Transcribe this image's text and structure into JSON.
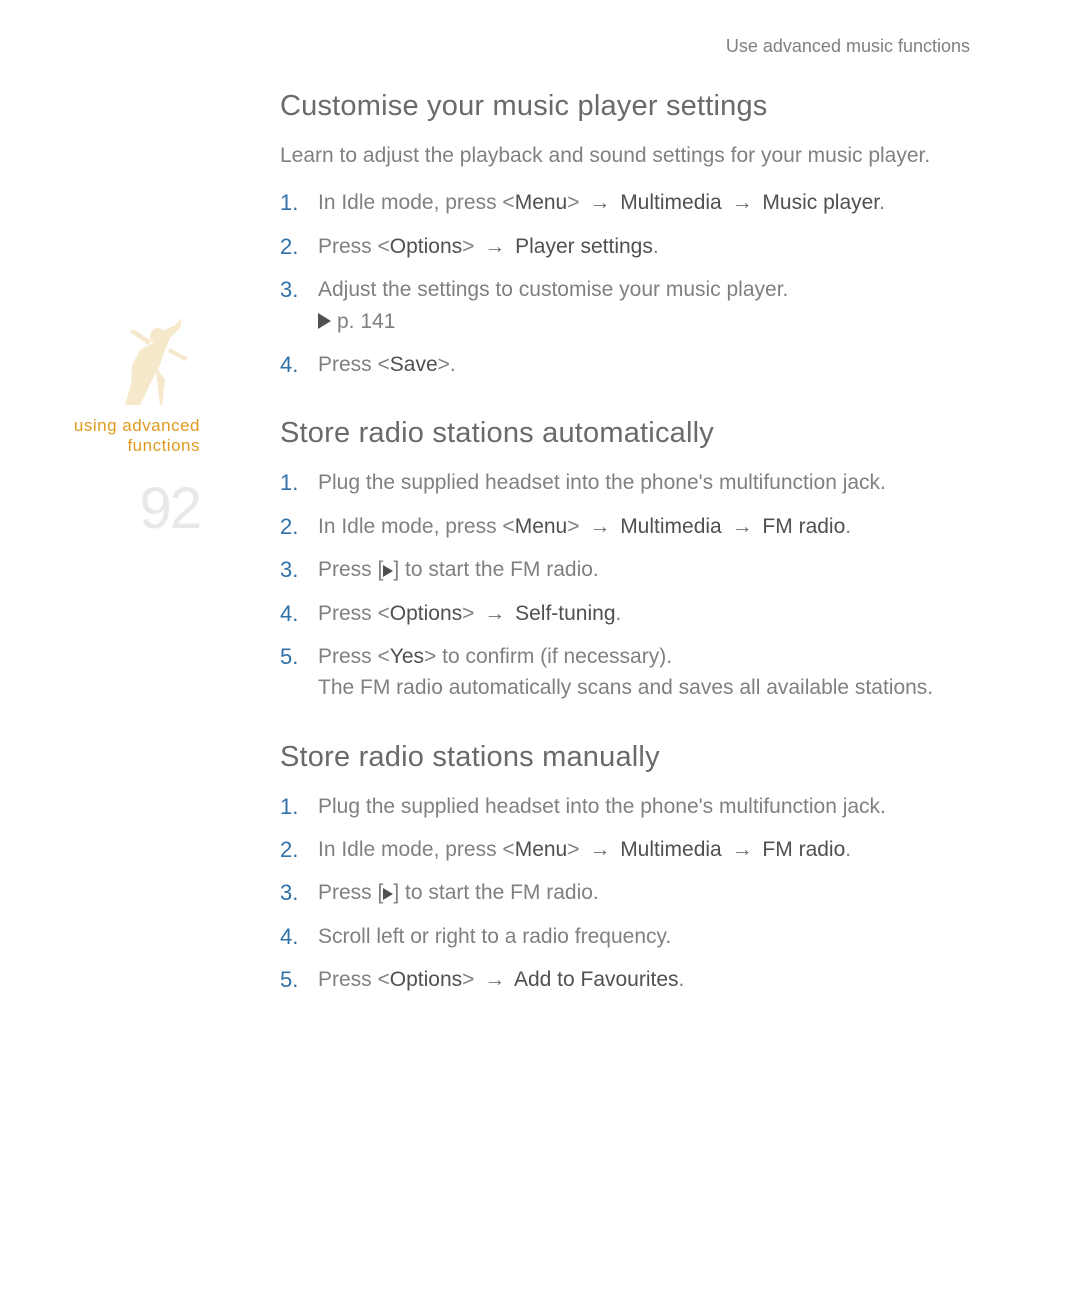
{
  "header": "Use advanced music functions",
  "sidebar": {
    "label1": "using advanced",
    "label2": "functions",
    "pageNumber": "92"
  },
  "s1": {
    "title": "Customise your music player settings",
    "intro": "Learn to adjust the playback and sound settings for your music player.",
    "i1": {
      "a": "In Idle mode, press <",
      "b": "Menu",
      "c": "> ",
      "d": "Multimedia",
      "e": "Music player",
      "f": "."
    },
    "i2": {
      "a": "Press <",
      "b": "Options",
      "c": "> ",
      "d": "Player settings",
      "e": "."
    },
    "i3": {
      "a": "Adjust the settings to customise your music player.",
      "ref": "p. 141"
    },
    "i4": {
      "a": "Press <",
      "b": "Save",
      "c": ">."
    }
  },
  "s2": {
    "title": "Store radio stations automatically",
    "i1": "Plug the supplied headset into the phone's multifunction jack.",
    "i2": {
      "a": "In Idle mode, press <",
      "b": "Menu",
      "c": "> ",
      "d": "Multimedia",
      "e": "FM radio",
      "f": "."
    },
    "i3": {
      "a": "Press [",
      "b": "] to start the FM radio."
    },
    "i4": {
      "a": "Press <",
      "b": "Options",
      "c": "> ",
      "d": "Self-tuning",
      "e": "."
    },
    "i5": {
      "a": "Press <",
      "b": "Yes",
      "c": "> to confirm (if necessary).",
      "sub": "The FM radio automatically scans and saves all available stations."
    }
  },
  "s3": {
    "title": "Store radio stations manually",
    "i1": "Plug the supplied headset into the phone's multifunction jack.",
    "i2": {
      "a": "In Idle mode, press <",
      "b": "Menu",
      "c": "> ",
      "d": "Multimedia",
      "e": "FM radio",
      "f": "."
    },
    "i3": {
      "a": "Press [",
      "b": "] to start the FM radio."
    },
    "i4": "Scroll left or right to a radio frequency.",
    "i5": {
      "a": "Press <",
      "b": "Options",
      "c": "> ",
      "d": "Add to Favourites",
      "e": "."
    }
  },
  "arrow": "→"
}
